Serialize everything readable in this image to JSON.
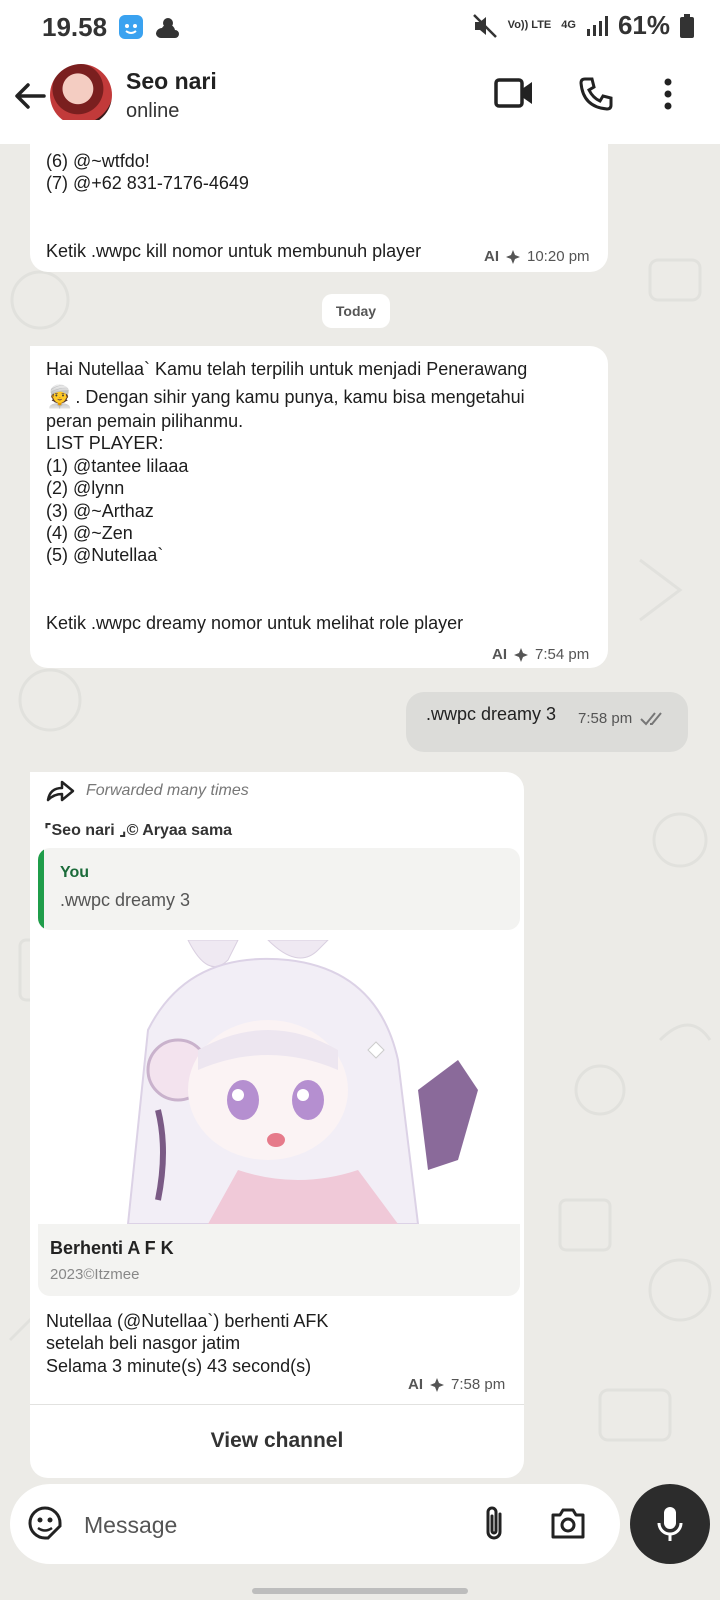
{
  "status_bar": {
    "time": "19.58",
    "network_lte": "Vo)) LTE",
    "network_4g": "4G",
    "battery": "61%"
  },
  "header": {
    "name": "Seo nari",
    "status": "online"
  },
  "messages": {
    "m1": {
      "lines": "(6) @~wtfdo!\n(7) @+62 831-7176-4649\n\n\nKetik .wwpc kill nomor untuk membunuh player",
      "ai_label": "AI",
      "time": "10:20 pm"
    },
    "date_chip": "Today",
    "m2": {
      "line1": "Hai Nutellaa` Kamu telah terpilih  untuk menjadi Penerawang",
      "emoji": "👳",
      "line2": ". Dengan sihir yang kamu punya, kamu bisa mengetahui",
      "body": "peran pemain pilihanmu.\nLIST PLAYER:\n(1) @tantee lilaaa\n(2) @lynn\n(3) @~Arthaz\n(4) @~Zen\n(5) @Nutellaa`\n\n\nKetik .wwpc dreamy nomor untuk melihat role player",
      "ai_label": "AI",
      "time": "7:54 pm"
    },
    "m3": {
      "text": ".wwpc dreamy 3",
      "time": "7:58 pm"
    },
    "m4": {
      "forwarded": "Forwarded many times",
      "sender": "⌜Seo nari ⌟© Aryaa sama",
      "quote_author": "You",
      "quote_text": ".wwpc dreamy 3",
      "link_title": "Berhenti A F K",
      "link_subtitle": "2023©Itzmee",
      "body": "Nutellaa (@Nutellaa`) berhenti AFK\n setelah beli nasgor jatim\nSelama 3 minute(s) 43 second(s)",
      "ai_label": "AI",
      "time": "7:58 pm",
      "view_channel": "View channel"
    }
  },
  "composer": {
    "placeholder": "Message"
  }
}
